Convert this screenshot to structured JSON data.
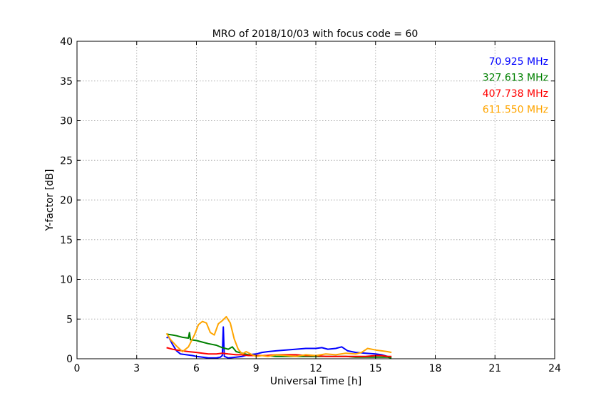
{
  "chart_data": {
    "type": "line",
    "title": "MRO of 2018/10/03 with focus code = 60",
    "xlabel": "Universal Time [h]",
    "ylabel": "Y-factor [dB]",
    "xlim": [
      0,
      24
    ],
    "ylim": [
      0,
      40
    ],
    "xticks": [
      0,
      3,
      6,
      9,
      12,
      15,
      18,
      21,
      24
    ],
    "yticks": [
      0,
      5,
      10,
      15,
      20,
      25,
      30,
      35,
      40
    ],
    "grid": true,
    "legend_placement": "top-right",
    "series": [
      {
        "name": "70.925 MHz",
        "color": "#0000ff",
        "x": [
          4.5,
          4.6,
          4.8,
          5.0,
          5.2,
          5.5,
          5.8,
          6.0,
          6.3,
          6.6,
          7.0,
          7.2,
          7.3,
          7.35,
          7.4,
          7.6,
          8.0,
          8.3,
          8.6,
          9.0,
          9.3,
          9.6,
          10.0,
          10.5,
          11.0,
          11.5,
          12.0,
          12.3,
          12.6,
          13.0,
          13.3,
          13.6,
          14.0,
          14.5,
          15.0,
          15.3,
          15.6,
          15.8
        ],
        "y": [
          2.6,
          2.8,
          1.8,
          1.0,
          0.6,
          0.5,
          0.4,
          0.3,
          0.2,
          0.1,
          0.1,
          0.2,
          0.4,
          4.0,
          0.3,
          0.1,
          0.2,
          0.3,
          0.5,
          0.6,
          0.8,
          0.9,
          1.0,
          1.1,
          1.2,
          1.3,
          1.3,
          1.4,
          1.2,
          1.3,
          1.5,
          1.0,
          0.8,
          0.7,
          0.6,
          0.5,
          0.3,
          0.2
        ]
      },
      {
        "name": "327.613 MHz",
        "color": "#008000",
        "x": [
          4.5,
          4.8,
          5.0,
          5.3,
          5.6,
          5.65,
          5.7,
          6.0,
          6.3,
          6.6,
          7.0,
          7.3,
          7.6,
          7.8,
          8.0,
          8.3,
          8.6,
          9.0,
          9.5,
          10.0,
          10.5,
          11.0,
          11.5,
          12.0,
          12.5,
          13.0,
          13.5,
          14.0,
          14.5,
          15.0,
          15.3,
          15.6,
          15.8
        ],
        "y": [
          3.1,
          3.0,
          2.9,
          2.7,
          2.6,
          3.3,
          2.4,
          2.3,
          2.1,
          1.9,
          1.7,
          1.4,
          1.2,
          1.5,
          0.9,
          0.7,
          0.5,
          0.4,
          0.4,
          0.3,
          0.3,
          0.3,
          0.3,
          0.3,
          0.3,
          0.3,
          0.3,
          0.2,
          0.2,
          0.2,
          0.2,
          0.2,
          0.1
        ]
      },
      {
        "name": "407.738 MHz",
        "color": "#ff0000",
        "x": [
          4.5,
          4.8,
          5.0,
          5.3,
          5.6,
          6.0,
          6.3,
          6.6,
          7.0,
          7.3,
          7.6,
          8.0,
          8.3,
          8.6,
          9.0,
          9.5,
          10.0,
          10.5,
          11.0,
          11.5,
          12.0,
          12.5,
          13.0,
          13.5,
          14.0,
          14.5,
          15.0,
          15.3,
          15.6,
          15.8
        ],
        "y": [
          1.4,
          1.2,
          1.1,
          1.0,
          0.9,
          0.8,
          0.7,
          0.6,
          0.6,
          0.7,
          0.6,
          0.5,
          0.5,
          0.4,
          0.4,
          0.4,
          0.5,
          0.5,
          0.5,
          0.4,
          0.4,
          0.3,
          0.3,
          0.3,
          0.3,
          0.3,
          0.4,
          0.4,
          0.3,
          0.3
        ]
      },
      {
        "name": "611.550 MHz",
        "color": "#ffa500",
        "x": [
          4.5,
          4.7,
          5.0,
          5.3,
          5.6,
          5.9,
          6.1,
          6.3,
          6.5,
          6.7,
          6.9,
          7.1,
          7.3,
          7.5,
          7.7,
          7.9,
          8.1,
          8.3,
          8.5,
          8.8,
          9.0,
          9.3,
          9.6,
          10.0,
          10.5,
          11.0,
          11.5,
          12.0,
          12.5,
          13.0,
          13.5,
          14.0,
          14.3,
          14.6,
          15.0,
          15.3,
          15.6,
          15.8
        ],
        "y": [
          3.2,
          2.4,
          1.6,
          0.9,
          1.5,
          3.0,
          4.3,
          4.7,
          4.5,
          3.3,
          3.0,
          4.4,
          4.8,
          5.3,
          4.5,
          2.5,
          1.2,
          0.6,
          0.9,
          0.5,
          0.3,
          0.4,
          0.3,
          0.5,
          0.4,
          0.3,
          0.5,
          0.4,
          0.6,
          0.5,
          0.7,
          0.6,
          0.8,
          1.3,
          1.1,
          1.0,
          0.9,
          0.8
        ]
      }
    ]
  }
}
